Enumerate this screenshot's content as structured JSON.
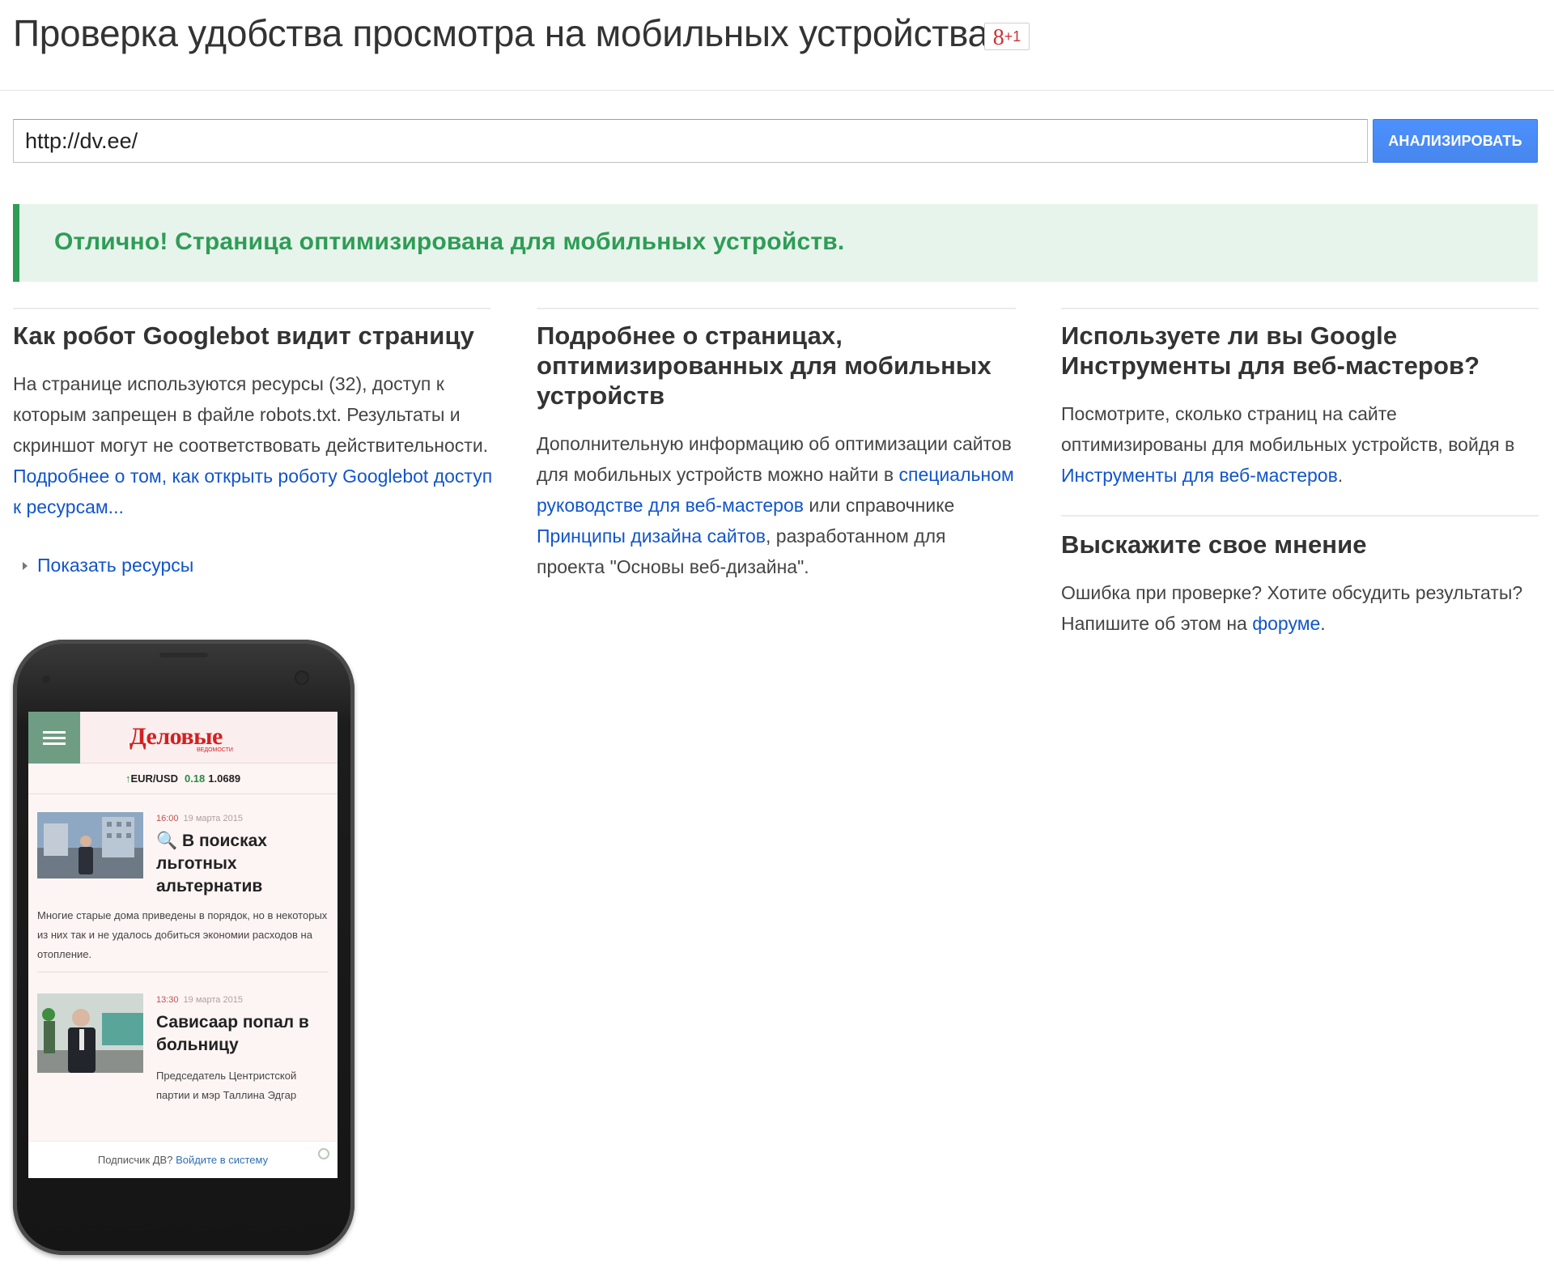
{
  "header": {
    "title": "Проверка удобства просмотра на мобильных устройствах",
    "gplus_g": "8",
    "gplus_plus1": "+1"
  },
  "search": {
    "url_value": "http://dv.ee/",
    "analyze_label": "АНАЛИЗИРОВАТЬ"
  },
  "result": {
    "message": "Отлично! Страница оптимизирована для мобильных устройств."
  },
  "left": {
    "heading": "Как робот Googlebot видит страницу",
    "text": "На странице используются ресурсы (32), доступ к которым запрещен в файле robots.txt. Результаты и скриншот могут не соответствовать действительности. ",
    "link": "Подробнее о том, как открыть роботу Googlebot доступ к ресурсам...",
    "show_resources": "Показать ресурсы"
  },
  "middle": {
    "heading": "Подробнее о страницах, оптимизированных для мобильных устройств",
    "text1": "Дополнительную информацию об оптимизации сайтов для мобильных устройств можно найти в ",
    "link1": "специальном руководстве для веб-мастеров",
    "text2": " или справочнике ",
    "link2": "Принципы дизайна сайтов",
    "text3": ", разработанном для проекта \"Основы веб-дизайна\"."
  },
  "right": {
    "heading": "Используете ли вы Google Инструменты для веб-мастеров?",
    "text1": "Посмотрите, сколько страниц на сайте оптимизированы для мобильных устройств, войдя в ",
    "link1": "Инструменты для веб-мастеров",
    "text1_end": ".",
    "feedback_heading": "Выскажите свое мнение",
    "text2": "Ошибка при проверке? Хотите обсудить результаты? Напишите об этом на ",
    "link2": "форуме",
    "text2_end": "."
  },
  "phone_preview": {
    "logo": "Деловые",
    "logo_sub": "ВЕДОМОСТИ",
    "rate_arrow": "↑",
    "rate_pair": "EUR/USD",
    "rate_change": "0.18",
    "rate_value": "1.0689",
    "articles": [
      {
        "time": "16:00",
        "date": "19 марта 2015",
        "title": "🔍 В поисках льготных альтернатив",
        "lead": "Многие старые дома приведены в порядок, но в некоторых из них так и не удалось добиться экономии расходов на отопление."
      },
      {
        "time": "13:30",
        "date": "19 марта 2015",
        "title": "Сависаар попал в больницу",
        "lead": "Председатель Центристской партии и мэр Таллина Эдгар"
      }
    ],
    "footer_text": "Подписчик ДВ? ",
    "footer_link": "Войдите в систему"
  },
  "colors": {
    "accent_blue": "#4d90fe",
    "link_blue": "#1155cc",
    "success_green": "#2e9d55",
    "success_bg": "#e7f4ec",
    "logo_red": "#d32020"
  }
}
